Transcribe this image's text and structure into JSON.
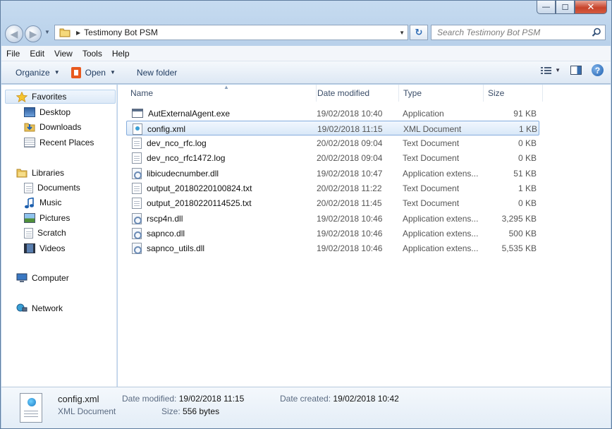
{
  "window": {
    "caption_buttons": {
      "minimize": "—",
      "maximize": "☐",
      "close": "✕"
    }
  },
  "address": {
    "path": "Testimony Bot PSM",
    "search_placeholder": "Search Testimony Bot PSM"
  },
  "menu": [
    "File",
    "Edit",
    "View",
    "Tools",
    "Help"
  ],
  "commands": {
    "organize": "Organize",
    "open": "Open",
    "new_folder": "New folder"
  },
  "nav": {
    "favorites": "Favorites",
    "desktop": "Desktop",
    "downloads": "Downloads",
    "recent": "Recent Places",
    "libraries": "Libraries",
    "documents": "Documents",
    "music": "Music",
    "pictures": "Pictures",
    "scratch": "Scratch",
    "videos": "Videos",
    "computer": "Computer",
    "network": "Network"
  },
  "columns": {
    "name": "Name",
    "date": "Date modified",
    "type": "Type",
    "size": "Size"
  },
  "files": [
    {
      "name": "AutExternalAgent.exe",
      "date": "19/02/2018 10:40",
      "type": "Application",
      "size": "91 KB",
      "icon": "exe-icon"
    },
    {
      "name": "config.xml",
      "date": "19/02/2018 11:15",
      "type": "XML Document",
      "size": "1 KB",
      "icon": "xml-file-icon"
    },
    {
      "name": "dev_nco_rfc.log",
      "date": "20/02/2018 09:04",
      "type": "Text Document",
      "size": "0 KB",
      "icon": "text-file-icon"
    },
    {
      "name": "dev_nco_rfc1472.log",
      "date": "20/02/2018 09:04",
      "type": "Text Document",
      "size": "0 KB",
      "icon": "text-file-icon"
    },
    {
      "name": "libicudecnumber.dll",
      "date": "19/02/2018 10:47",
      "type": "Application extens...",
      "size": "51 KB",
      "icon": "dll-file-icon"
    },
    {
      "name": "output_20180220100824.txt",
      "date": "20/02/2018 11:22",
      "type": "Text Document",
      "size": "1 KB",
      "icon": "text-file-icon"
    },
    {
      "name": "output_20180220114525.txt",
      "date": "20/02/2018 11:45",
      "type": "Text Document",
      "size": "0 KB",
      "icon": "text-file-icon"
    },
    {
      "name": "rscp4n.dll",
      "date": "19/02/2018 10:46",
      "type": "Application extens...",
      "size": "3,295 KB",
      "icon": "dll-file-icon"
    },
    {
      "name": "sapnco.dll",
      "date": "19/02/2018 10:46",
      "type": "Application extens...",
      "size": "500 KB",
      "icon": "dll-file-icon"
    },
    {
      "name": "sapnco_utils.dll",
      "date": "19/02/2018 10:46",
      "type": "Application extens...",
      "size": "5,535 KB",
      "icon": "dll-file-icon"
    }
  ],
  "details": {
    "name": "config.xml",
    "type": "XML Document",
    "date_modified_label": "Date modified:",
    "date_modified": "19/02/2018 11:15",
    "date_created_label": "Date created:",
    "date_created": "19/02/2018 10:42",
    "size_label": "Size:",
    "size": "556 bytes"
  }
}
